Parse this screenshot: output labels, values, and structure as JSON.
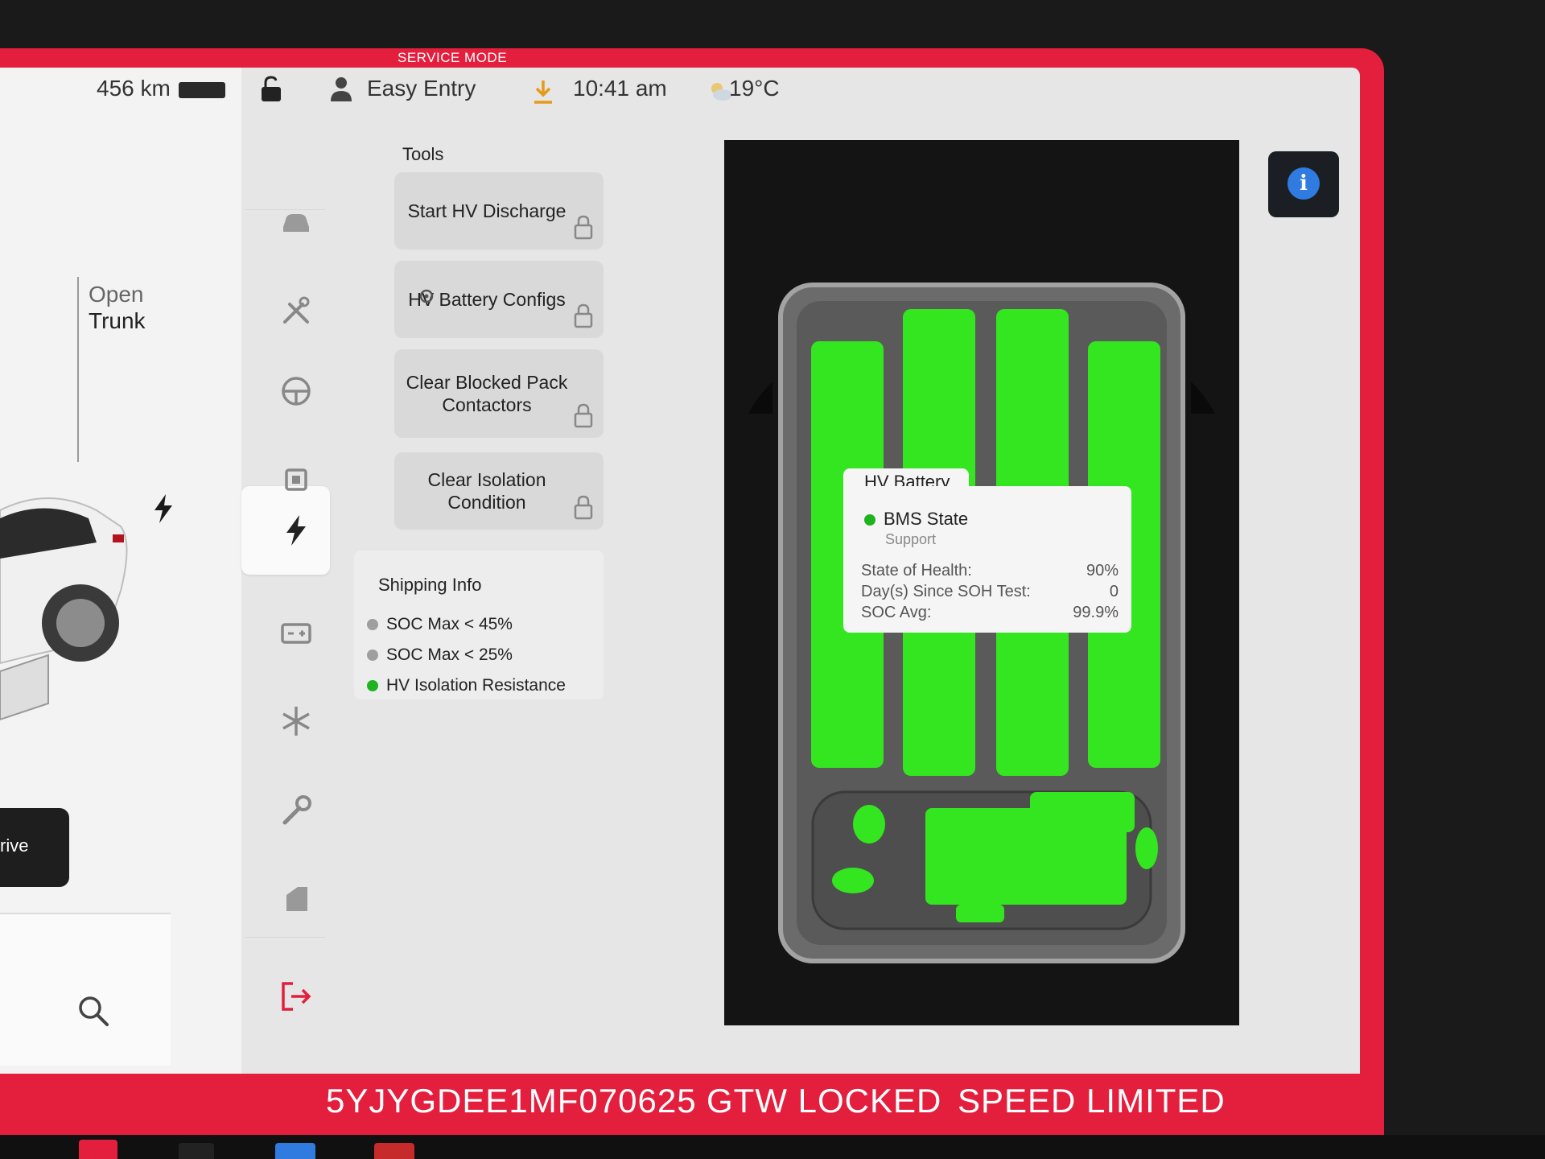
{
  "service_mode_label": "SERVICE MODE",
  "status": {
    "range": "456 km",
    "profile": "Easy Entry",
    "time": "10:41 am",
    "temperature": "19°C"
  },
  "car_panel": {
    "open_trunk": [
      "Open",
      "Trunk"
    ],
    "drive_label": "rive"
  },
  "nav_icons": [
    "car-icon",
    "tools-icon",
    "steering-wheel-icon",
    "chip-icon",
    "lightning-icon",
    "battery-icon",
    "snowflake-icon",
    "wrench-icon",
    "door-icon",
    "exit-icon"
  ],
  "tools": {
    "title": "Tools",
    "buttons": [
      {
        "label": "Start HV Discharge",
        "locked": true
      },
      {
        "label": "HV Battery Configs",
        "locked": true
      },
      {
        "label": "Clear Blocked Pack Contactors",
        "locked": true
      },
      {
        "label": "Clear Isolation Condition",
        "locked": true
      }
    ]
  },
  "shipping_info": {
    "title": "Shipping Info",
    "items": [
      {
        "label": "SOC Max < 45%",
        "status": "gray"
      },
      {
        "label": "SOC Max < 25%",
        "status": "gray"
      },
      {
        "label": "HV Isolation Resistance",
        "status": "green"
      }
    ]
  },
  "hv_battery": {
    "title": "HV Battery",
    "bms_label": "BMS State",
    "bms_value": "Support",
    "rows": [
      {
        "label": "State of Health:",
        "value": "90%"
      },
      {
        "label": "Day(s) Since SOH Test:",
        "value": "0"
      },
      {
        "label": "SOC Avg:",
        "value": "99.9%"
      }
    ]
  },
  "banner": {
    "vin": "5YJYGDEE1MF070625",
    "gtw": "GTW LOCKED",
    "speed": "SPEED LIMITED"
  },
  "colors": {
    "service_red": "#e31f3d",
    "module_green": "#33e61f",
    "status_green": "#1fb31f",
    "status_gray": "#9e9e9e",
    "info_blue": "#2f7be0"
  }
}
